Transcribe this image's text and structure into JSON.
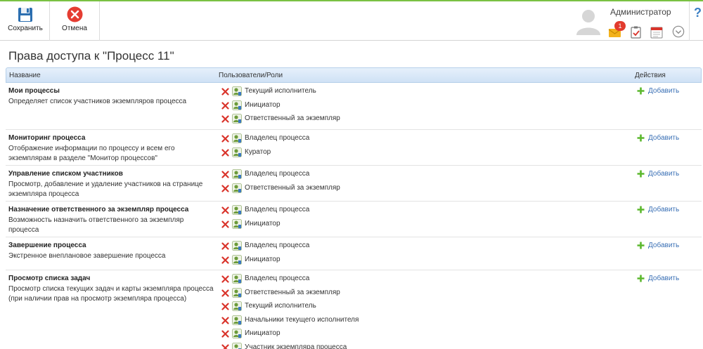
{
  "toolbar": {
    "save_label": "Сохранить",
    "cancel_label": "Отмена"
  },
  "header": {
    "user_name": "Администратор",
    "notification_count": "1",
    "help_label": "?"
  },
  "page": {
    "title": "Права доступа к \"Процесс 11\""
  },
  "table": {
    "columns": [
      "Название",
      "Пользователи/Роли",
      "Действия"
    ],
    "add_label": "Добавить",
    "rows": [
      {
        "name": "Мои процессы",
        "description": "Определяет список участников экземпляров процесса",
        "roles": [
          "Текущий исполнитель",
          "Инициатор",
          "Ответственный за экземпляр"
        ]
      },
      {
        "name": "Мониторинг процесса",
        "description": "Отображение информации по процессу и всем его экземплярам в разделе \"Монитор процессов\"",
        "roles": [
          "Владелец процесса",
          "Куратор"
        ]
      },
      {
        "name": "Управление списком участников",
        "description": "Просмотр, добавление и удаление участников на странице экземпляра процесса",
        "roles": [
          "Владелец процесса",
          "Ответственный за экземпляр"
        ]
      },
      {
        "name": "Назначение ответственного за экземпляр процесса",
        "description": "Возможность назначить ответственного за экземпляр процесса",
        "roles": [
          "Владелец процесса",
          "Инициатор"
        ]
      },
      {
        "name": "Завершение процесса",
        "description": "Экстренное внеплановое завершение процесса",
        "roles": [
          "Владелец процесса",
          "Инициатор"
        ]
      },
      {
        "name": "Просмотр списка задач",
        "description": "Просмотр списка текущих задач и карты экземпляра процесса (при наличии прав на просмотр экземпляра процесса)",
        "roles": [
          "Владелец процесса",
          "Ответственный за экземпляр",
          "Текущий исполнитель",
          "Начальники текущего исполнителя",
          "Инициатор",
          "Участник экземпляра процесса"
        ]
      }
    ]
  },
  "colors": {
    "accent_green": "#7ac143",
    "link_blue": "#3a70b5",
    "remove_red": "#d9342b",
    "header_bg": "#d8e7f7"
  }
}
